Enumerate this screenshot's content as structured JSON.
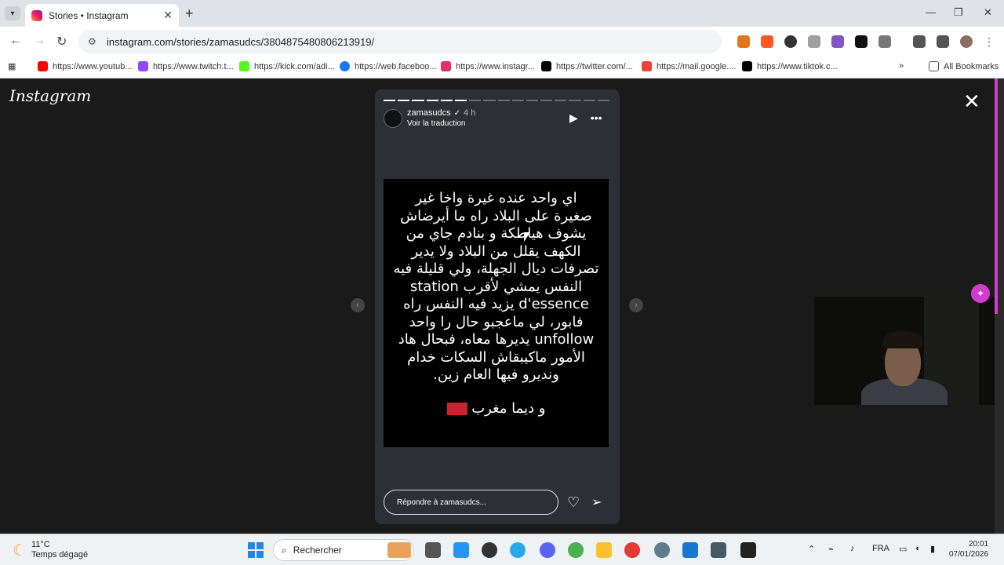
{
  "browser": {
    "tab_title": "Stories • Instagram",
    "tab_close": "✕",
    "new_tab": "+",
    "url": "instagram.com/stories/zamasudcs/3804875480806213919/",
    "window": {
      "minimize": "—",
      "restore": "❐",
      "close": "✕"
    },
    "nav": {
      "back": "←",
      "forward": "→",
      "reload": "↻"
    },
    "bookmarks": [
      {
        "label": "https://www.youtub...",
        "color": "#ff0000"
      },
      {
        "label": "https://www.twitch.t...",
        "color": "#9146ff"
      },
      {
        "label": "https://kick.com/adi...",
        "color": "#53fc18"
      },
      {
        "label": "https://web.faceboo...",
        "color": "#1877f2"
      },
      {
        "label": "https://www.instagr...",
        "color": "#e1306c"
      },
      {
        "label": "https://twitter.com/...",
        "color": "#000000"
      },
      {
        "label": "https://mail.google....",
        "color": "#ea4335"
      },
      {
        "label": "https://www.tiktok.c...",
        "color": "#010101"
      }
    ],
    "bookmarks_more": "»",
    "all_bookmarks": "All Bookmarks"
  },
  "instagram": {
    "logo": "Instagram",
    "close": "✕",
    "story": {
      "progress_total": 16,
      "progress_done": 6,
      "username": "zamasudcs",
      "verified": "✓",
      "time": "4 h",
      "translate": "Voir la traduction",
      "play": "▶",
      "more": "•••",
      "text_lines": [
        "اي واحد عنده غيرة واخا غير",
        "صغيرة على البلاد راه ما أيرضاش",
        "يشوف هياطكة و بنادم جاي من",
        "الكهف يقلل من البلاد ولا يدير",
        "تصرفات ديال الجهلة، ولي قليلة فيه",
        "النفس يمشي لأقرب station",
        "d'essence يزيد فيه النفس راه",
        "فابور، لي ماعجبو حال را واحد",
        "unfollow يديرها معاه، فبحال هاد",
        "الأمور ماكيبقاش السكات خدام",
        "ونديرو فيها العام زين."
      ],
      "sign_off": "و ديما مغرب",
      "reply_placeholder": "Répondre à zamasudcs...",
      "like": "♡",
      "share": "➢",
      "prev": "‹",
      "next": "›"
    }
  },
  "taskbar": {
    "temp": "11°C",
    "weather": "Temps dégagé",
    "search": "Rechercher",
    "lang": "FRA",
    "time": "20:01",
    "date": "07/01/2026"
  }
}
